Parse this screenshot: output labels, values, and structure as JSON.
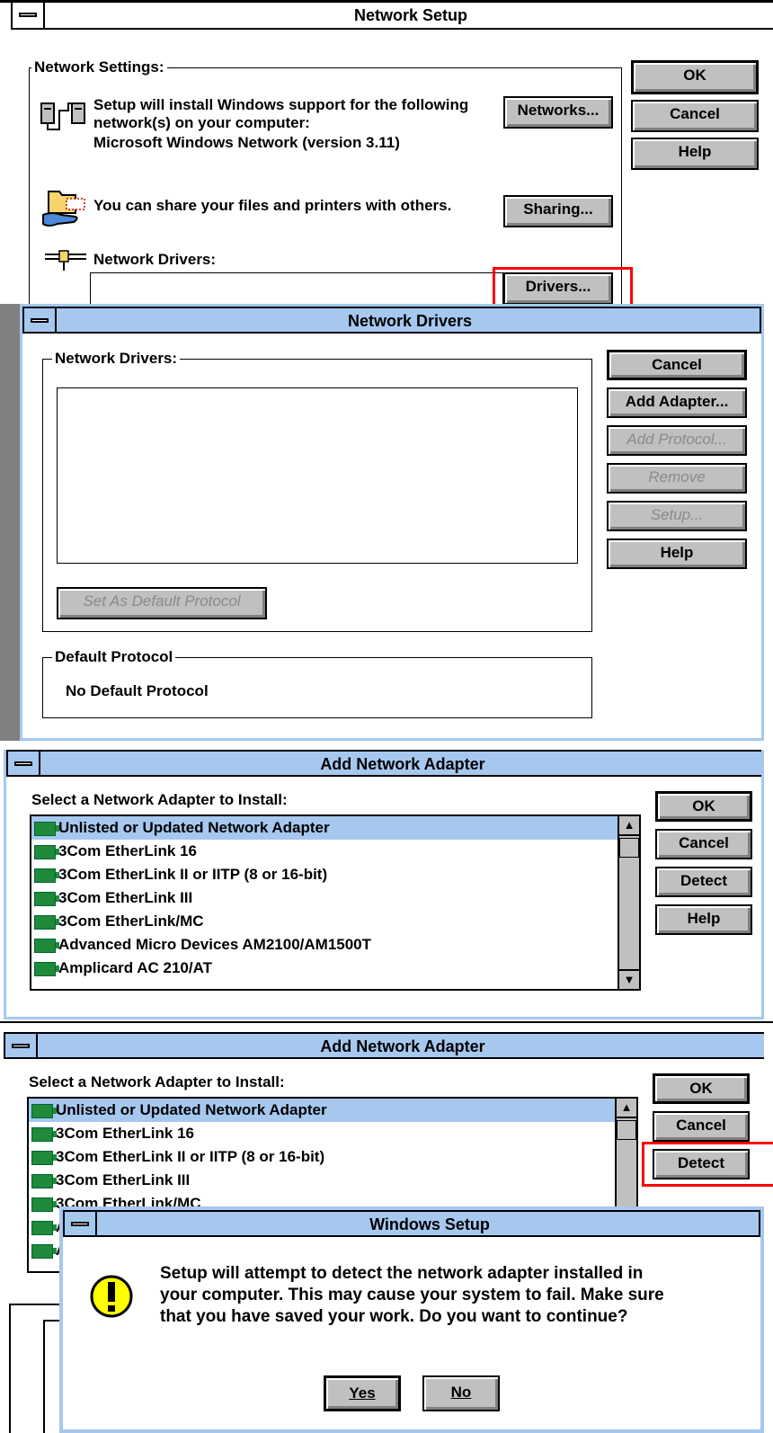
{
  "network_setup": {
    "title": "Network Setup",
    "group_label": "Network Settings:",
    "install_text_1": "Setup will install Windows support for the following",
    "install_text_2": "network(s) on your computer:",
    "network_name": "Microsoft Windows Network (version 3.11)",
    "share_text": "You can share your files and printers with others.",
    "drivers_label": "Network Drivers:",
    "buttons": {
      "ok": "OK",
      "cancel": "Cancel",
      "help": "Help",
      "networks": "Networks...",
      "sharing": "Sharing...",
      "drivers": "Drivers..."
    }
  },
  "network_drivers": {
    "title": "Network Drivers",
    "group_label": "Network Drivers:",
    "default_protocol_label": "Default Protocol",
    "default_protocol_value": "No Default Protocol",
    "buttons": {
      "cancel": "Cancel",
      "add_adapter": "Add Adapter...",
      "add_protocol": "Add Protocol...",
      "remove": "Remove",
      "setup": "Setup...",
      "help": "Help",
      "set_default": "Set As Default Protocol"
    }
  },
  "add_adapter": {
    "title": "Add Network Adapter",
    "prompt": "Select a Network Adapter to Install:",
    "items": [
      "Unlisted or Updated Network Adapter",
      "3Com EtherLink 16",
      "3Com EtherLink II or IITP (8 or 16-bit)",
      "3Com EtherLink III",
      "3Com EtherLink/MC",
      "Advanced Micro Devices AM2100/AM1500T",
      "Amplicard AC 210/AT"
    ],
    "buttons": {
      "ok": "OK",
      "cancel": "Cancel",
      "detect": "Detect",
      "help": "Help"
    }
  },
  "windows_setup": {
    "title": "Windows Setup",
    "message_1": "Setup will attempt to detect the network adapter installed in",
    "message_2": "your computer. This may cause your system to fail. Make sure",
    "message_3": "that you have saved your work. Do you want to continue?",
    "buttons": {
      "yes": "Yes",
      "no": "No"
    }
  },
  "highlight_color": "#ff0000",
  "titlebar_color": "#a6c8ef"
}
